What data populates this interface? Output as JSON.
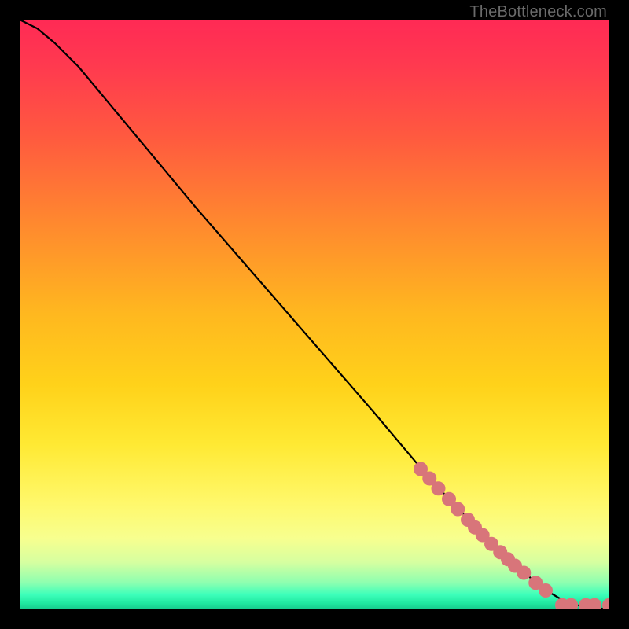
{
  "watermark": "TheBottleneck.com",
  "colors": {
    "background_black": "#000000",
    "curve": "#000000",
    "dots_fill": "#d8757a",
    "dots_stroke": "#b85a5f",
    "gradient_stops": [
      {
        "offset": 0.0,
        "color": "#ff2a55"
      },
      {
        "offset": 0.08,
        "color": "#ff3a4f"
      },
      {
        "offset": 0.2,
        "color": "#ff5a3f"
      },
      {
        "offset": 0.35,
        "color": "#ff8a2e"
      },
      {
        "offset": 0.5,
        "color": "#ffb81f"
      },
      {
        "offset": 0.62,
        "color": "#ffd21a"
      },
      {
        "offset": 0.72,
        "color": "#ffe933"
      },
      {
        "offset": 0.82,
        "color": "#fff86b"
      },
      {
        "offset": 0.88,
        "color": "#f7ff8f"
      },
      {
        "offset": 0.92,
        "color": "#d6ffa0"
      },
      {
        "offset": 0.955,
        "color": "#8dffb0"
      },
      {
        "offset": 0.975,
        "color": "#3dffba"
      },
      {
        "offset": 0.99,
        "color": "#1fe79f"
      },
      {
        "offset": 1.0,
        "color": "#17c98c"
      }
    ]
  },
  "chart_data": {
    "type": "line",
    "title": "",
    "xlabel": "",
    "ylabel": "",
    "xlim": [
      0,
      100
    ],
    "ylim": [
      0,
      100
    ],
    "series": [
      {
        "name": "curve",
        "x": [
          0,
          3,
          6,
          10,
          15,
          20,
          30,
          40,
          50,
          60,
          68,
          70,
          72,
          74,
          76,
          78,
          80,
          82,
          84,
          86,
          87,
          88,
          90,
          92,
          94,
          95,
          96,
          98,
          100
        ],
        "y": [
          100,
          98.5,
          96,
          92,
          86,
          80,
          68,
          56.5,
          45,
          33.5,
          24,
          21.8,
          19.6,
          17.5,
          15.4,
          13.4,
          11.4,
          9.5,
          7.7,
          5.9,
          5.0,
          4.2,
          2.8,
          1.6,
          0.9,
          0.6,
          0.4,
          0.2,
          0.0
        ]
      }
    ],
    "scatter_points": {
      "name": "dots",
      "points": [
        {
          "x": 68.0,
          "y": 23.8
        },
        {
          "x": 69.5,
          "y": 22.2
        },
        {
          "x": 71.0,
          "y": 20.5
        },
        {
          "x": 72.8,
          "y": 18.7
        },
        {
          "x": 74.3,
          "y": 17.0
        },
        {
          "x": 76.0,
          "y": 15.2
        },
        {
          "x": 77.2,
          "y": 13.9
        },
        {
          "x": 78.5,
          "y": 12.6
        },
        {
          "x": 80.0,
          "y": 11.1
        },
        {
          "x": 81.5,
          "y": 9.7
        },
        {
          "x": 82.8,
          "y": 8.5
        },
        {
          "x": 84.0,
          "y": 7.4
        },
        {
          "x": 85.5,
          "y": 6.2
        },
        {
          "x": 87.5,
          "y": 4.5
        },
        {
          "x": 89.2,
          "y": 3.2
        },
        {
          "x": 92.0,
          "y": 0.7
        },
        {
          "x": 93.5,
          "y": 0.7
        },
        {
          "x": 96.0,
          "y": 0.7
        },
        {
          "x": 97.5,
          "y": 0.7
        },
        {
          "x": 100.0,
          "y": 0.7
        }
      ],
      "radius_px": 9
    }
  }
}
